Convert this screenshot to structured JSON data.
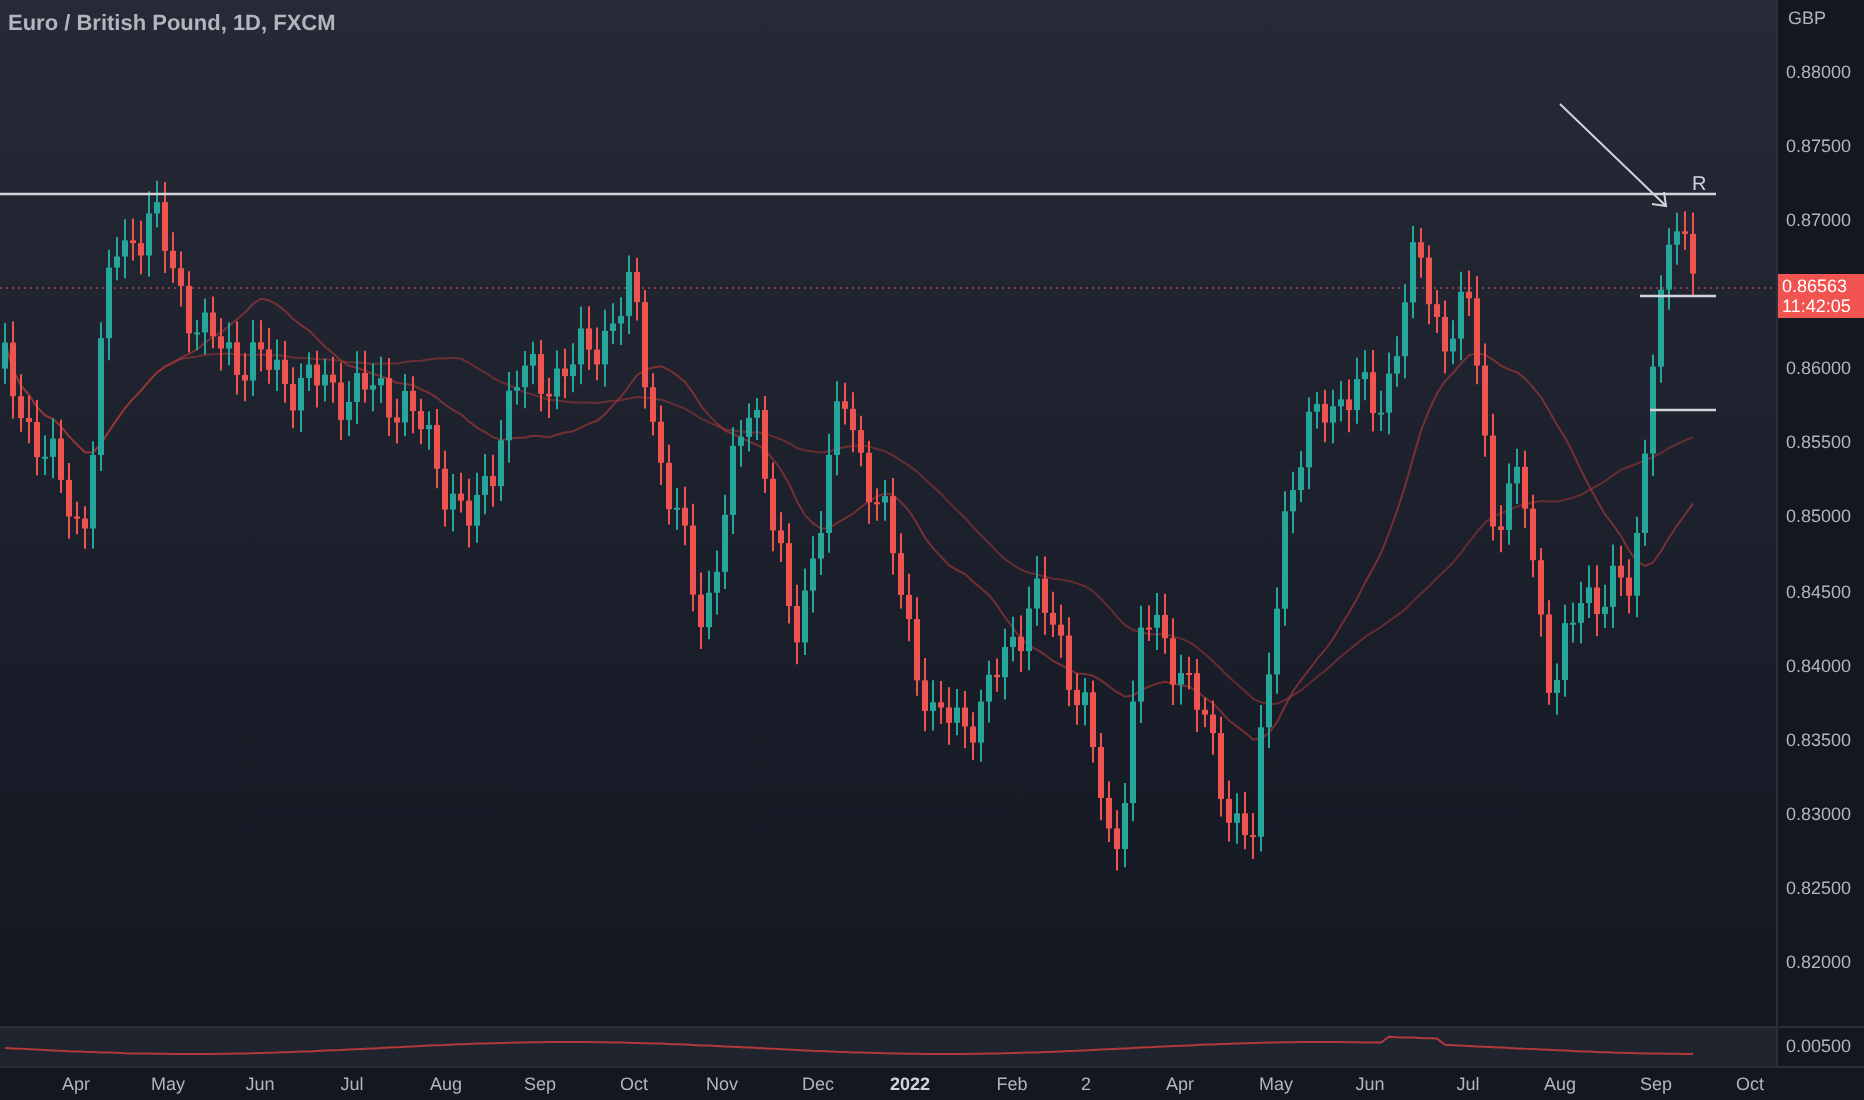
{
  "title": "Euro / British Pound, 1D, FXCM",
  "annotation_label": "R",
  "price_axis": {
    "currency": "GBP",
    "ticks": [
      "0.88000",
      "0.87500",
      "0.87000",
      "0.86000",
      "0.85500",
      "0.85000",
      "0.84500",
      "0.84000",
      "0.83500",
      "0.83000",
      "0.82500",
      "0.82000"
    ],
    "current_price": {
      "value": "0.86563",
      "countdown": "11:42:05"
    }
  },
  "indicator_axis": {
    "tick": "0.00500"
  },
  "time_axis": [
    {
      "label": "Apr",
      "bold": false
    },
    {
      "label": "May",
      "bold": false
    },
    {
      "label": "Jun",
      "bold": false
    },
    {
      "label": "Jul",
      "bold": false
    },
    {
      "label": "Aug",
      "bold": false
    },
    {
      "label": "Sep",
      "bold": false
    },
    {
      "label": "Oct",
      "bold": false
    },
    {
      "label": "Nov",
      "bold": false
    },
    {
      "label": "Dec",
      "bold": false
    },
    {
      "label": "2022",
      "bold": true
    },
    {
      "label": "Feb",
      "bold": false
    },
    {
      "label": "2",
      "bold": false
    },
    {
      "label": "Apr",
      "bold": false
    },
    {
      "label": "May",
      "bold": false
    },
    {
      "label": "Jun",
      "bold": false
    },
    {
      "label": "Jul",
      "bold": false
    },
    {
      "label": "Aug",
      "bold": false
    },
    {
      "label": "Sep",
      "bold": false
    },
    {
      "label": "Oct",
      "bold": false
    }
  ]
}
